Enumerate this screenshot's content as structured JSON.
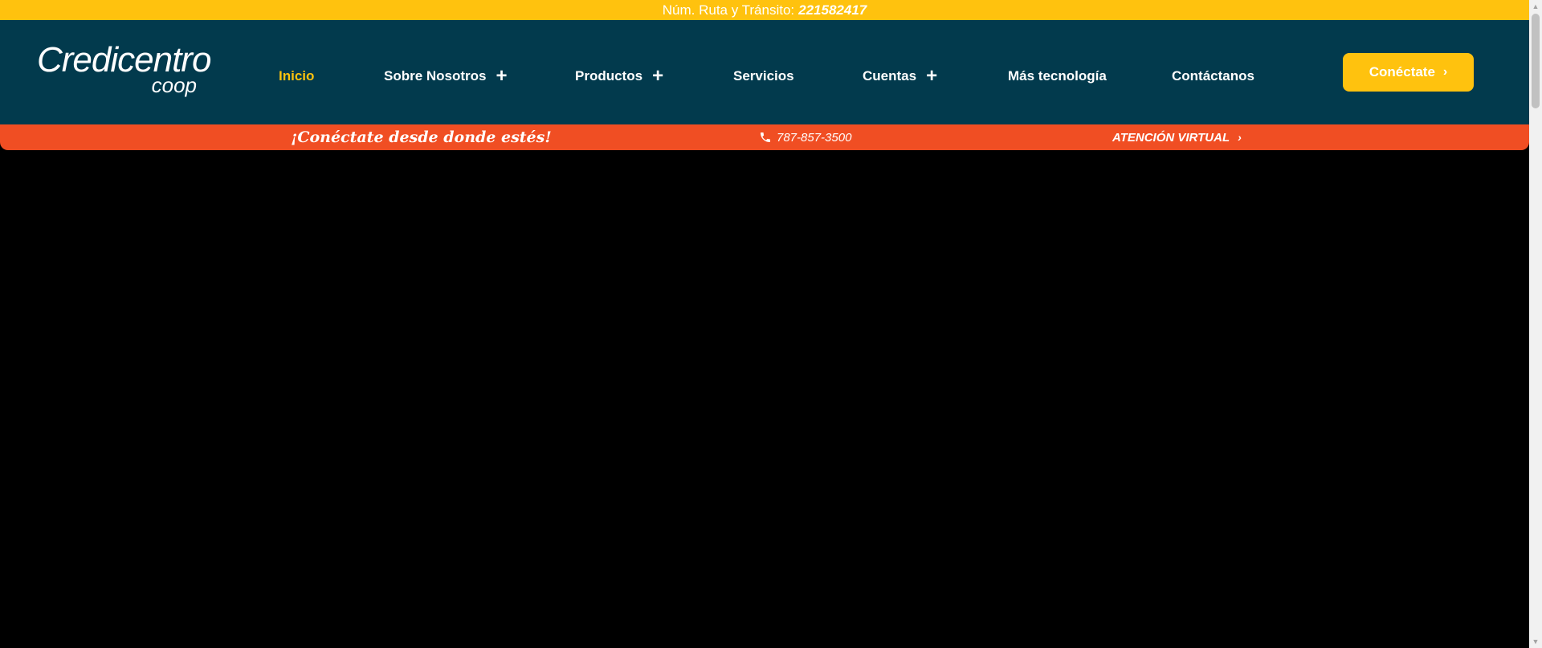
{
  "colors": {
    "yellow": "#FFC20E",
    "navy": "#023A4D",
    "orange": "#F04E23",
    "active_nav": "#FFC20E",
    "hero_bg": "#000000"
  },
  "topbar": {
    "label": "Núm. Ruta y Tránsito:",
    "number": "221582417"
  },
  "logo": {
    "main": "Credicentro",
    "sub": "coop"
  },
  "nav": {
    "items": [
      {
        "label": "Inicio",
        "active": true,
        "expandable": false
      },
      {
        "label": "Sobre Nosotros",
        "active": false,
        "expandable": true
      },
      {
        "label": "Productos",
        "active": false,
        "expandable": true
      },
      {
        "label": "Servicios",
        "active": false,
        "expandable": false
      },
      {
        "label": "Cuentas",
        "active": false,
        "expandable": true
      },
      {
        "label": "Más tecnología",
        "active": false,
        "expandable": false
      },
      {
        "label": "Contáctanos",
        "active": false,
        "expandable": false
      }
    ],
    "plus_icon": "+",
    "cta_label": "Conéctate",
    "chevron": "›"
  },
  "subbar": {
    "slogan": "¡Conéctate desde donde estés!",
    "phone": "787-857-3500",
    "virtual": "ATENCIÓN VIRTUAL",
    "phone_icon": "phone-icon"
  }
}
